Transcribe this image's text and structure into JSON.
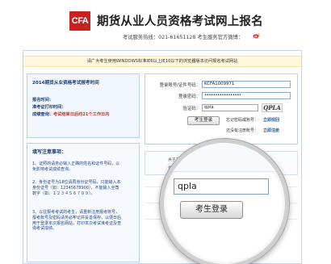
{
  "header": {
    "logo_text": "CFA",
    "title": "期货从业人员资格考试网上报名",
    "hotline": "考试服务热线：021-61651128 考生服务官方微博：",
    "weibo_icon": "weibo-icon"
  },
  "notice": "请广大考生使用WINDOWS标准IE6以上IE10以下的浏览器版本访问报名考试网站",
  "exam_info": {
    "title": "2014期货从业资格考试报考时间",
    "lines": [
      {
        "label": "报名时间：",
        "value": ""
      },
      {
        "label": "准考证打印时间：",
        "value": ""
      },
      {
        "label": "成绩查询：",
        "value": "考试结束日后约21个工作日内"
      }
    ]
  },
  "notes": {
    "title": "填写注意事项：",
    "paragraphs": [
      "1、证照的请务必输入正确的姓名和证件号码，以免影响考试成绩查询。",
      "2、身份证号为18位请再身份证号码，只能输入本身份证号（如：12345678900），不能输入全角数字（如：１２３４５６７８９）。",
      "3、以往报考考试的考生，请重新注册报考账号，报考账号及密码请务必牢记并妥善保存，以便日后用于登录本次报名网站，打印本次考试准考证及查询考试成绩。"
    ]
  },
  "login_form": {
    "account_label": "登录账号/证件号码：",
    "account_value": "KCFA1009971",
    "password_label": "登录密码：",
    "password_value": "•••••••••••••••••",
    "captcha_label": "验证码：",
    "captcha_value": "qpla",
    "captcha_image_text": "QPLA",
    "login_button": "考生登录",
    "forgot_label": "忘记密码或账号：",
    "forgot_link": "立即找回",
    "register_label": "还没有注册账号：",
    "register_link": "立即注册"
  },
  "stats": [
    "关于2014年度期货从业人员资格考试报名的公告(第1号)",
    "关于2014年度期货从业人员资格考试报名的公告(第2号)"
  ],
  "magnifier": {
    "captcha_value": "qpla",
    "login_button": "考生登录"
  },
  "colors": {
    "brand_red": "#c9211e",
    "link_blue": "#1a57b4",
    "heading_blue": "#1c3e78"
  }
}
